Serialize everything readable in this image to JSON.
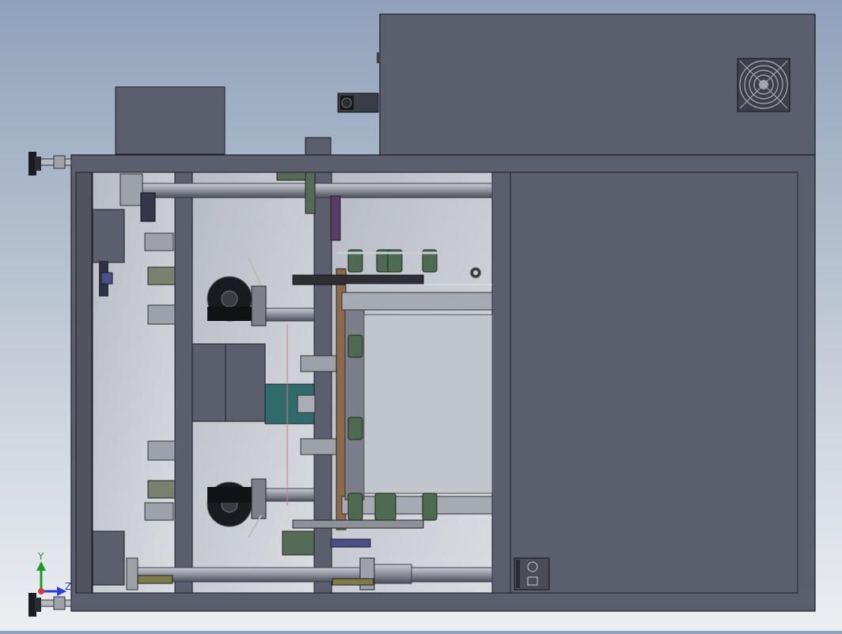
{
  "viewport": {
    "background_top": "#8fa2bb",
    "background_bottom": "#eceff2",
    "model_body_color": "#5b5e6c",
    "model_edge_color": "#1d1e24"
  },
  "axis_triad": {
    "x_label": "Z",
    "y_label": "Y",
    "x_color": "#2a3fd6",
    "y_color": "#1f9a2c"
  },
  "icons": {
    "fan": "fan-grille-icon",
    "switch": "power-switch-icon"
  }
}
